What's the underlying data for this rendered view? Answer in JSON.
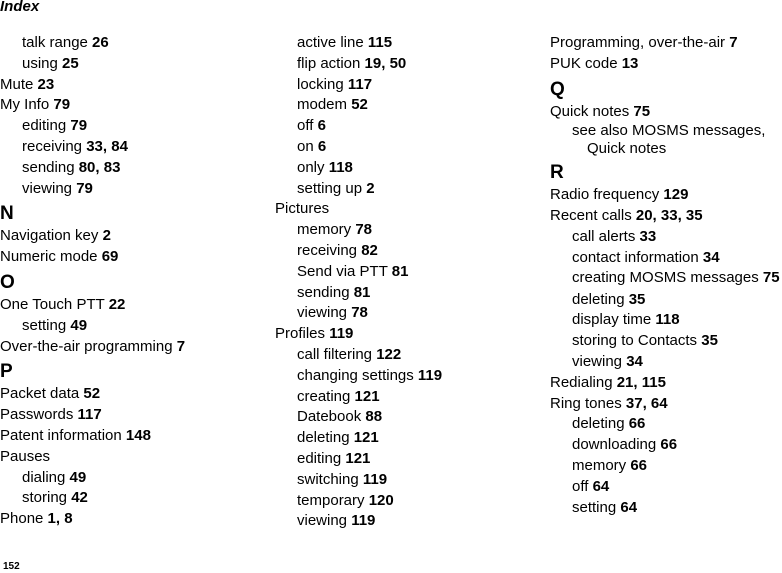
{
  "header": {
    "title": "Index"
  },
  "footer": {
    "page_number": "152"
  },
  "columns": [
    {
      "items": [
        {
          "type": "sub",
          "text": "talk range",
          "pages": "26"
        },
        {
          "type": "sub",
          "text": "using",
          "pages": "25"
        },
        {
          "type": "main",
          "text": "Mute",
          "pages": "23"
        },
        {
          "type": "main",
          "text": "My Info",
          "pages": "79"
        },
        {
          "type": "sub",
          "text": "editing",
          "pages": "79"
        },
        {
          "type": "sub",
          "text": "receiving",
          "pages": "33, 84"
        },
        {
          "type": "sub",
          "text": "sending",
          "pages": "80, 83"
        },
        {
          "type": "sub",
          "text": "viewing",
          "pages": "79"
        },
        {
          "type": "letter",
          "text": "N"
        },
        {
          "type": "main",
          "text": "Navigation key",
          "pages": "2"
        },
        {
          "type": "main",
          "text": "Numeric mode",
          "pages": "69"
        },
        {
          "type": "letter",
          "text": "O"
        },
        {
          "type": "main",
          "text": "One Touch PTT",
          "pages": "22"
        },
        {
          "type": "sub",
          "text": "setting",
          "pages": "49"
        },
        {
          "type": "main",
          "text": "Over-the-air programming",
          "pages": "7"
        },
        {
          "type": "letter",
          "text": "P"
        },
        {
          "type": "main",
          "text": "Packet data",
          "pages": "52"
        },
        {
          "type": "main",
          "text": "Passwords",
          "pages": "117"
        },
        {
          "type": "main",
          "text": "Patent information",
          "pages": "148"
        },
        {
          "type": "main",
          "text": "Pauses",
          "pages": ""
        },
        {
          "type": "sub",
          "text": "dialing",
          "pages": "49"
        },
        {
          "type": "sub",
          "text": "storing",
          "pages": "42"
        },
        {
          "type": "main",
          "text": "Phone",
          "pages": "1, 8"
        }
      ]
    },
    {
      "items": [
        {
          "type": "sub",
          "text": "active line",
          "pages": "115"
        },
        {
          "type": "sub",
          "text": "flip action",
          "pages": "19, 50"
        },
        {
          "type": "sub",
          "text": "locking",
          "pages": "117"
        },
        {
          "type": "sub",
          "text": "modem",
          "pages": "52"
        },
        {
          "type": "sub",
          "text": "off",
          "pages": "6"
        },
        {
          "type": "sub",
          "text": "on",
          "pages": "6"
        },
        {
          "type": "sub",
          "text": "only",
          "pages": "118"
        },
        {
          "type": "sub",
          "text": "setting up",
          "pages": "2"
        },
        {
          "type": "main",
          "text": "Pictures",
          "pages": ""
        },
        {
          "type": "sub",
          "text": "memory",
          "pages": "78"
        },
        {
          "type": "sub",
          "text": "receiving",
          "pages": "82"
        },
        {
          "type": "sub",
          "text": "Send via PTT",
          "pages": "81"
        },
        {
          "type": "sub",
          "text": "sending",
          "pages": "81"
        },
        {
          "type": "sub",
          "text": "viewing",
          "pages": "78"
        },
        {
          "type": "main",
          "text": "Profiles",
          "pages": "119"
        },
        {
          "type": "sub",
          "text": "call filtering",
          "pages": "122"
        },
        {
          "type": "sub",
          "text": "changing settings",
          "pages": "119"
        },
        {
          "type": "sub",
          "text": "creating",
          "pages": "121"
        },
        {
          "type": "sub",
          "text": "Datebook",
          "pages": "88"
        },
        {
          "type": "sub",
          "text": "deleting",
          "pages": "121"
        },
        {
          "type": "sub",
          "text": "editing",
          "pages": "121"
        },
        {
          "type": "sub",
          "text": "switching",
          "pages": "119"
        },
        {
          "type": "sub",
          "text": "temporary",
          "pages": "120"
        },
        {
          "type": "sub",
          "text": "viewing",
          "pages": "119"
        }
      ]
    },
    {
      "items": [
        {
          "type": "main",
          "text": "Programming, over-the-air",
          "pages": "7"
        },
        {
          "type": "main",
          "text": "PUK code",
          "pages": "13"
        },
        {
          "type": "letter",
          "text": "Q"
        },
        {
          "type": "main",
          "text": "Quick notes",
          "pages": "75"
        },
        {
          "type": "wrap",
          "text": "see also MOSMS messages, Quick notes",
          "pages": ""
        },
        {
          "type": "letter",
          "text": "R"
        },
        {
          "type": "main",
          "text": "Radio frequency",
          "pages": "129"
        },
        {
          "type": "main",
          "text": "Recent calls",
          "pages": "20, 33, 35"
        },
        {
          "type": "sub",
          "text": "call alerts",
          "pages": "33"
        },
        {
          "type": "sub",
          "text": "contact information",
          "pages": "34"
        },
        {
          "type": "wrap",
          "text": "creating MOSMS messages",
          "pages": "75"
        },
        {
          "type": "sub",
          "text": "deleting",
          "pages": "35"
        },
        {
          "type": "sub",
          "text": "display time",
          "pages": "118"
        },
        {
          "type": "sub",
          "text": "storing to Contacts",
          "pages": "35"
        },
        {
          "type": "sub",
          "text": "viewing",
          "pages": "34"
        },
        {
          "type": "main",
          "text": "Redialing",
          "pages": "21, 115"
        },
        {
          "type": "main",
          "text": "Ring tones",
          "pages": "37, 64"
        },
        {
          "type": "sub",
          "text": "deleting",
          "pages": "66"
        },
        {
          "type": "sub",
          "text": "downloading",
          "pages": "66"
        },
        {
          "type": "sub",
          "text": "memory",
          "pages": "66"
        },
        {
          "type": "sub",
          "text": "off",
          "pages": "64"
        },
        {
          "type": "sub",
          "text": "setting",
          "pages": "64"
        }
      ]
    }
  ]
}
